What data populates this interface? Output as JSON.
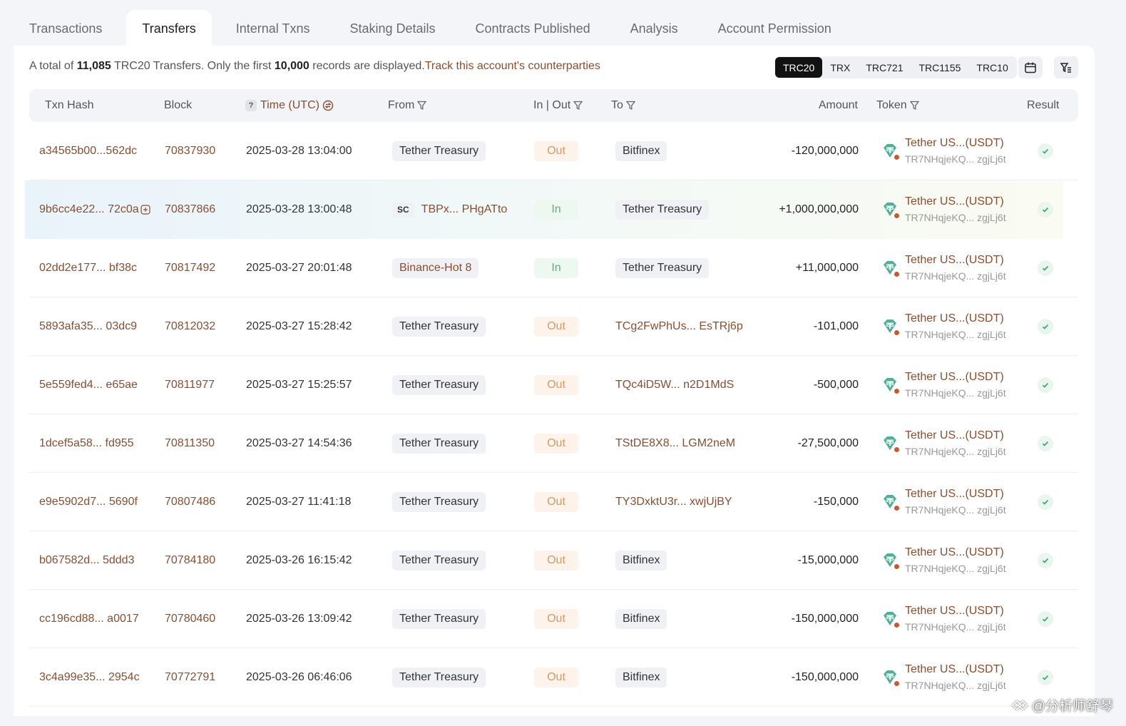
{
  "tabs": [
    {
      "label": "Transactions",
      "active": false
    },
    {
      "label": "Transfers",
      "active": true
    },
    {
      "label": "Internal Txns",
      "active": false
    },
    {
      "label": "Staking Details",
      "active": false
    },
    {
      "label": "Contracts Published",
      "active": false
    },
    {
      "label": "Analysis",
      "active": false
    },
    {
      "label": "Account Permission",
      "active": false
    }
  ],
  "summary": {
    "prefix": "A total of ",
    "total": "11,085",
    "mid": " TRC20 Transfers. Only the first ",
    "shown": "10,000",
    "suffix": " records are displayed.",
    "track_link": "Track this account's counterparties"
  },
  "token_types": [
    {
      "label": "TRC20",
      "active": true
    },
    {
      "label": "TRX",
      "active": false
    },
    {
      "label": "TRC721",
      "active": false
    },
    {
      "label": "TRC1155",
      "active": false
    },
    {
      "label": "TRC10",
      "active": false
    }
  ],
  "columns": {
    "hash": "Txn Hash",
    "block": "Block",
    "time": "Time (UTC)",
    "time_help": "?",
    "from": "From",
    "inout": "In | Out",
    "to": "To",
    "amount": "Amount",
    "token": "Token",
    "result": "Result"
  },
  "rows": [
    {
      "hash": "a34565b00...562dc",
      "block": "70837930",
      "time": "2025-03-28 13:04:00",
      "from": "Tether Treasury",
      "from_type": "tag",
      "dir": "Out",
      "to": "Bitfinex",
      "to_type": "tag",
      "amount": "-120,000,000",
      "token_name": "Tether US...(USDT)",
      "token_addr": "TR7NHqjeKQ... zgjLj6t"
    },
    {
      "hash": "9b6cc4e22... 72c0a",
      "block": "70837866",
      "time": "2025-03-28 13:00:48",
      "from": "TBPx... PHgATto",
      "from_type": "contract",
      "from_badge": "SC",
      "dir": "In",
      "to": "Tether Treasury",
      "to_type": "tag",
      "amount": "+1,000,000,000",
      "token_name": "Tether US...(USDT)",
      "token_addr": "TR7NHqjeKQ... zgjLj6t"
    },
    {
      "hash": "02dd2e177... bf38c",
      "block": "70817492",
      "time": "2025-03-27 20:01:48",
      "from": "Binance-Hot 8",
      "from_type": "tag-brown",
      "dir": "In",
      "to": "Tether Treasury",
      "to_type": "tag",
      "amount": "+11,000,000",
      "token_name": "Tether US...(USDT)",
      "token_addr": "TR7NHqjeKQ... zgjLj6t"
    },
    {
      "hash": "5893afa35... 03dc9",
      "block": "70812032",
      "time": "2025-03-27 15:28:42",
      "from": "Tether Treasury",
      "from_type": "tag",
      "dir": "Out",
      "to": "TCg2FwPhUs... EsTRj6p",
      "to_type": "addr",
      "amount": "-101,000",
      "token_name": "Tether US...(USDT)",
      "token_addr": "TR7NHqjeKQ... zgjLj6t"
    },
    {
      "hash": "5e559fed4... e65ae",
      "block": "70811977",
      "time": "2025-03-27 15:25:57",
      "from": "Tether Treasury",
      "from_type": "tag",
      "dir": "Out",
      "to": "TQc4iD5W... n2D1MdS",
      "to_type": "addr",
      "amount": "-500,000",
      "token_name": "Tether US...(USDT)",
      "token_addr": "TR7NHqjeKQ... zgjLj6t"
    },
    {
      "hash": "1dcef5a58... fd955",
      "block": "70811350",
      "time": "2025-03-27 14:54:36",
      "from": "Tether Treasury",
      "from_type": "tag",
      "dir": "Out",
      "to": "TStDE8X8... LGM2neM",
      "to_type": "addr",
      "amount": "-27,500,000",
      "token_name": "Tether US...(USDT)",
      "token_addr": "TR7NHqjeKQ... zgjLj6t"
    },
    {
      "hash": "e9e5902d7... 5690f",
      "block": "70807486",
      "time": "2025-03-27 11:41:18",
      "from": "Tether Treasury",
      "from_type": "tag",
      "dir": "Out",
      "to": "TY3DxktU3r... xwjUjBY",
      "to_type": "addr",
      "amount": "-150,000",
      "token_name": "Tether US...(USDT)",
      "token_addr": "TR7NHqjeKQ... zgjLj6t"
    },
    {
      "hash": "b067582d... 5ddd3",
      "block": "70784180",
      "time": "2025-03-26 16:15:42",
      "from": "Tether Treasury",
      "from_type": "tag",
      "dir": "Out",
      "to": "Bitfinex",
      "to_type": "tag",
      "amount": "-15,000,000",
      "token_name": "Tether US...(USDT)",
      "token_addr": "TR7NHqjeKQ... zgjLj6t"
    },
    {
      "hash": "cc196cd88... a0017",
      "block": "70780460",
      "time": "2025-03-26 13:09:42",
      "from": "Tether Treasury",
      "from_type": "tag",
      "dir": "Out",
      "to": "Bitfinex",
      "to_type": "tag",
      "amount": "-150,000,000",
      "token_name": "Tether US...(USDT)",
      "token_addr": "TR7NHqjeKQ... zgjLj6t"
    },
    {
      "hash": "3c4a99e35... 2954c",
      "block": "70772791",
      "time": "2025-03-26 06:46:06",
      "from": "Tether Treasury",
      "from_type": "tag",
      "dir": "Out",
      "to": "Bitfinex",
      "to_type": "tag",
      "amount": "-150,000,000",
      "token_name": "Tether US...(USDT)",
      "token_addr": "TR7NHqjeKQ... zgjLj6t"
    }
  ],
  "watermark": "@分析师舒琴",
  "icons": {
    "calendar": "calendar-icon",
    "filter_list": "filter-list-icon",
    "funnel": "funnel-icon",
    "sort": "sort-icon",
    "token": "tether-usdt-icon",
    "result": "check-icon",
    "expand": "plus-box-icon"
  },
  "colors": {
    "accent": "#8b4d2e",
    "out": "#d49a63",
    "in": "#5bb07e",
    "tether": "#50af95",
    "active_toggle": "#121212"
  }
}
